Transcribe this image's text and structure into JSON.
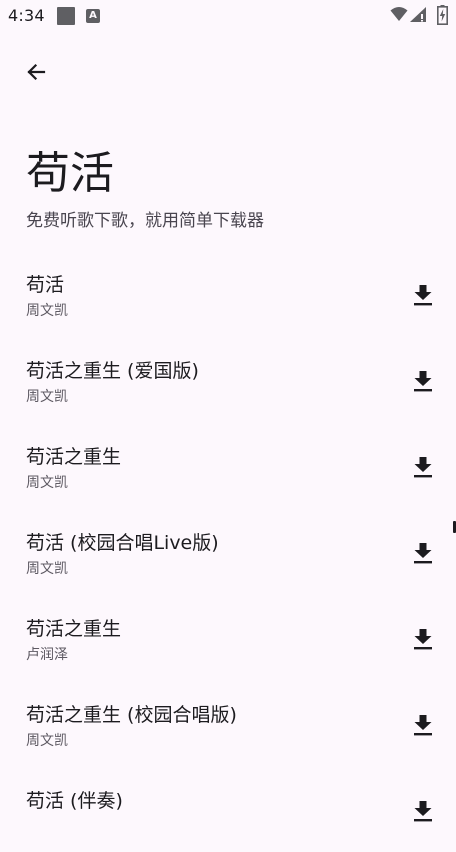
{
  "status_bar": {
    "time": "4:34",
    "notification_letter": "A"
  },
  "header": {
    "title": "苟活",
    "subtitle": "免费听歌下歌，就用简单下载器"
  },
  "songs": [
    {
      "title": "苟活",
      "artist": "周文凯"
    },
    {
      "title": "苟活之重生 (爱国版)",
      "artist": "周文凯"
    },
    {
      "title": "苟活之重生",
      "artist": "周文凯"
    },
    {
      "title": "苟活 (校园合唱Live版)",
      "artist": "周文凯"
    },
    {
      "title": "苟活之重生",
      "artist": "卢润泽"
    },
    {
      "title": "苟活之重生 (校园合唱版)",
      "artist": "周文凯"
    },
    {
      "title": "苟活 (伴奏)",
      "artist": ""
    }
  ],
  "icons": {
    "back": "arrow-back-icon",
    "download": "download-icon",
    "wifi": "wifi-icon",
    "signal": "signal-icon",
    "battery": "battery-charging-icon"
  },
  "colors": {
    "background": "#fdf8fd",
    "text_primary": "#1c1b1f",
    "text_secondary": "#49454f"
  }
}
